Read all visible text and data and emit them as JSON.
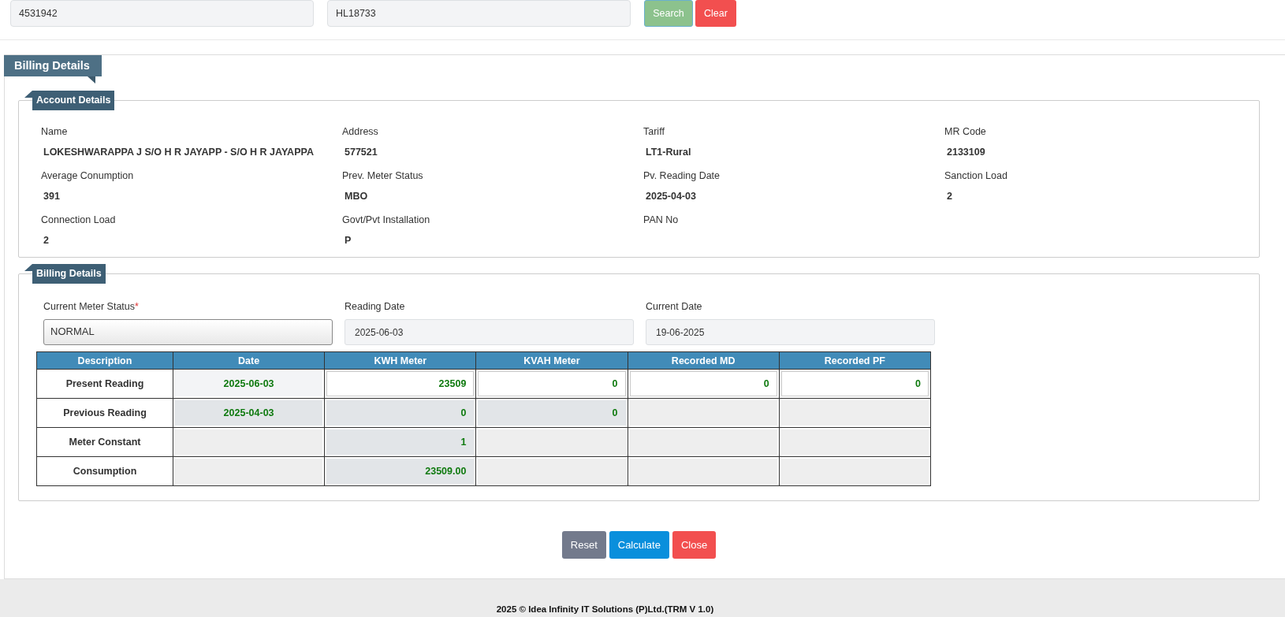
{
  "search_bar": {
    "fields": [
      {
        "value": "4531942"
      },
      {
        "value": "HL18733"
      }
    ],
    "buttons": [
      {
        "label": "Search",
        "kind": "search"
      },
      {
        "label": "Clear",
        "kind": "clear"
      }
    ]
  },
  "panel": {
    "title": "Billing Details",
    "account_details": {
      "title": "Account Details",
      "fields": [
        {
          "label": "Name",
          "value": "LOKESHWARAPPA J S/O H R JAYAPP - S/O H R JAYAPPA"
        },
        {
          "label": "Address",
          "value": "577521"
        },
        {
          "label": "Tariff",
          "value": "LT1-Rural"
        },
        {
          "label": "MR Code",
          "value": "2133109"
        },
        {
          "label": "Average Conumption",
          "value": "391"
        },
        {
          "label": "Prev. Meter Status",
          "value": "MBO"
        },
        {
          "label": "Pv. Reading Date",
          "value": "2025-04-03"
        },
        {
          "label": "Sanction Load",
          "value": "2"
        },
        {
          "label": "Connection Load",
          "value": "2"
        },
        {
          "label": "Govt/Pvt Installation",
          "value": "P"
        },
        {
          "label": "PAN No"
        }
      ]
    },
    "billing_details": {
      "title": "Billing Details",
      "inputs": [
        {
          "label": "Current Meter Status",
          "required_mark": "*",
          "kind": "select",
          "value": "NORMAL"
        },
        {
          "label": "Reading Date",
          "kind": "readonly",
          "value": "2025-06-03"
        },
        {
          "label": "Current Date",
          "kind": "readonly",
          "value": "19-06-2025"
        }
      ],
      "table": {
        "columns": [
          "Description",
          "Date",
          "KWH Meter",
          "KVAH Meter",
          "Recorded MD",
          "Recorded PF"
        ],
        "rows": [
          {
            "cells": [
              {
                "kind": "label",
                "value": "Present Reading"
              },
              {
                "kind": "light",
                "value": "2025-06-03"
              },
              {
                "kind": "editable",
                "value": "23509"
              },
              {
                "kind": "editable",
                "value": "0"
              },
              {
                "kind": "editable",
                "value": "0"
              },
              {
                "kind": "editable",
                "value": "0"
              }
            ]
          },
          {
            "cells": [
              {
                "kind": "label",
                "value": "Previous Reading"
              },
              {
                "kind": "readonly",
                "value": "2025-04-03"
              },
              {
                "kind": "readonly",
                "value": "0"
              },
              {
                "kind": "readonly",
                "value": "0"
              },
              {
                "kind": "empty"
              },
              {
                "kind": "empty"
              }
            ]
          },
          {
            "cells": [
              {
                "kind": "label",
                "value": "Meter Constant"
              },
              {
                "kind": "empty"
              },
              {
                "kind": "readonly",
                "value": "1"
              },
              {
                "kind": "empty"
              },
              {
                "kind": "empty"
              },
              {
                "kind": "empty"
              }
            ]
          },
          {
            "cells": [
              {
                "kind": "label",
                "value": "Consumption"
              },
              {
                "kind": "empty"
              },
              {
                "kind": "readonly",
                "value": "23509.00"
              },
              {
                "kind": "empty"
              },
              {
                "kind": "empty"
              },
              {
                "kind": "empty"
              }
            ]
          }
        ]
      }
    },
    "buttons": [
      {
        "label": "Reset",
        "kind": "reset"
      },
      {
        "label": "Calculate",
        "kind": "calculate"
      },
      {
        "label": "Close",
        "kind": "close"
      }
    ]
  },
  "footer": {
    "text": "2025 © Idea Infinity IT Solutions (P)Ltd.(TRM V 1.0)"
  }
}
